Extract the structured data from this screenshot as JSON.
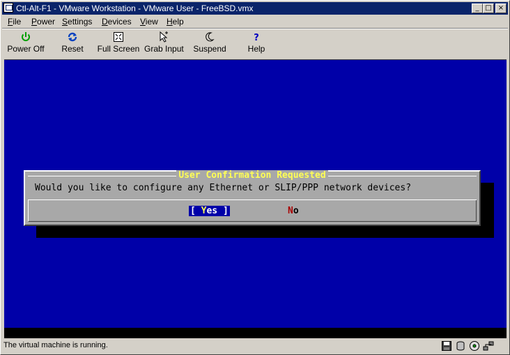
{
  "window": {
    "title": "Ctl-Alt-F1 - VMware Workstation - VMware User - FreeBSD.vmx",
    "controls": {
      "minimize": "_",
      "maximize": "□",
      "close": "×"
    }
  },
  "menubar": {
    "items": [
      {
        "hotkey": "F",
        "rest": "ile"
      },
      {
        "hotkey": "P",
        "rest": "ower"
      },
      {
        "hotkey": "S",
        "rest": "ettings"
      },
      {
        "hotkey": "D",
        "rest": "evices"
      },
      {
        "hotkey": "V",
        "rest": "iew"
      },
      {
        "hotkey": "H",
        "rest": "elp"
      }
    ]
  },
  "toolbar": {
    "power_off": "Power Off",
    "reset": "Reset",
    "full_screen": "Full Screen",
    "grab_input": "Grab Input",
    "suspend": "Suspend",
    "help": "Help",
    "icons": {
      "power_off": "power-icon",
      "reset": "reset-icon",
      "full_screen": "full-screen-icon",
      "grab_input": "grab-input-icon",
      "suspend": "suspend-moon-icon",
      "help": "help-question-icon"
    }
  },
  "dialog": {
    "title": "User Confirmation Requested",
    "question": "Would you like to configure any Ethernet or SLIP/PPP network devices?",
    "yes": {
      "open": "[ ",
      "hotkey": "Y",
      "rest": "es",
      "close": " ]"
    },
    "no": {
      "hotkey": "N",
      "rest": "o"
    }
  },
  "statusbar": {
    "text": "The virtual machine is running.",
    "icons": [
      "floppy-icon",
      "disk-icon",
      "cdrom-icon",
      "network-icon"
    ]
  },
  "colors": {
    "title_bar": "#0a246a",
    "console_bg": "#0000a8",
    "dialog_bg": "#a8a8a8",
    "dialog_title": "#ffff54",
    "no_hotkey": "#a80000"
  }
}
